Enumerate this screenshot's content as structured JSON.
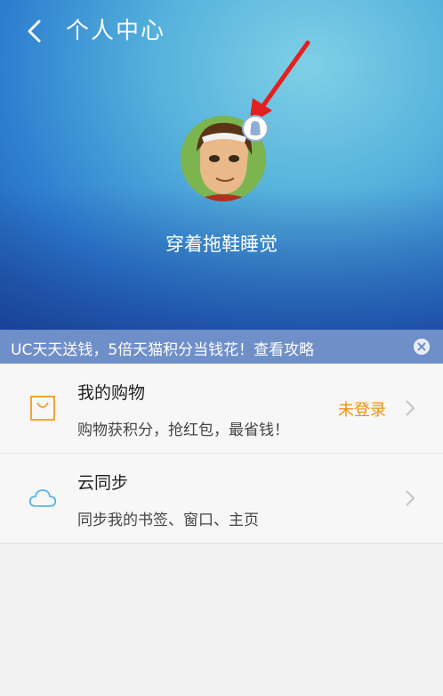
{
  "header": {
    "title": "个人中心",
    "username": "穿着拖鞋睡觉"
  },
  "banner": {
    "text": "UC天天送钱，5倍天猫积分当钱花！查看攻略"
  },
  "list": [
    {
      "title": "我的购物",
      "subtitle": "购物获积分，抢红包，最省钱！",
      "status": "未登录",
      "icon": "shopping-bag-icon"
    },
    {
      "title": "云同步",
      "subtitle": "同步我的书签、窗口、主页",
      "icon": "cloud-icon"
    }
  ],
  "colors": {
    "status": "#f0900f",
    "banner": "#6f8fc8",
    "arrow": "#e32020"
  }
}
